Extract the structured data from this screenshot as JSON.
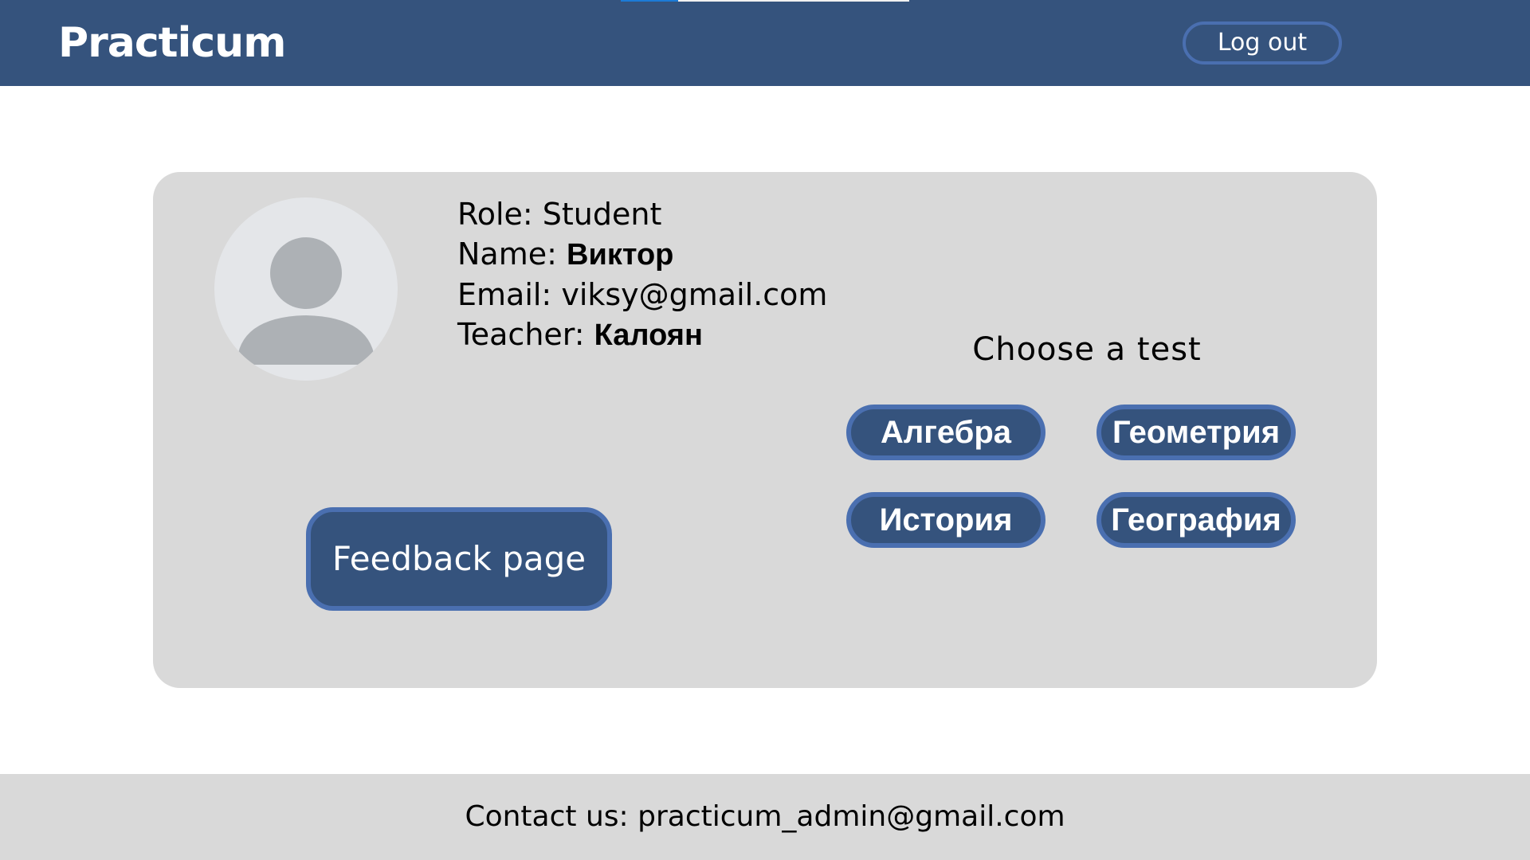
{
  "header": {
    "brand": "Practicum",
    "logout_label": "Log out"
  },
  "profile": {
    "avatar_icon": "user-avatar-icon",
    "role_label": "Role:",
    "role_value": "Student",
    "name_label": "Name:",
    "name_value": "Виктор",
    "email_label": "Email:",
    "email_value": "viksy@gmail.com",
    "teacher_label": "Teacher:",
    "teacher_value": "Калоян"
  },
  "tests": {
    "title": "Choose a test",
    "items": [
      {
        "label": "Алгебра"
      },
      {
        "label": "Геометрия"
      },
      {
        "label": "История"
      },
      {
        "label": "География"
      }
    ]
  },
  "feedback": {
    "label": "Feedback page"
  },
  "footer": {
    "contact_label": "Contact us:",
    "contact_email": "practicum_admin@gmail.com"
  },
  "colors": {
    "primary": "#35537d",
    "button_border": "#4a6fb0",
    "card_bg": "#d9d9d9",
    "avatar_bg": "#e4e6e9",
    "avatar_figure": "#adb1b5"
  }
}
